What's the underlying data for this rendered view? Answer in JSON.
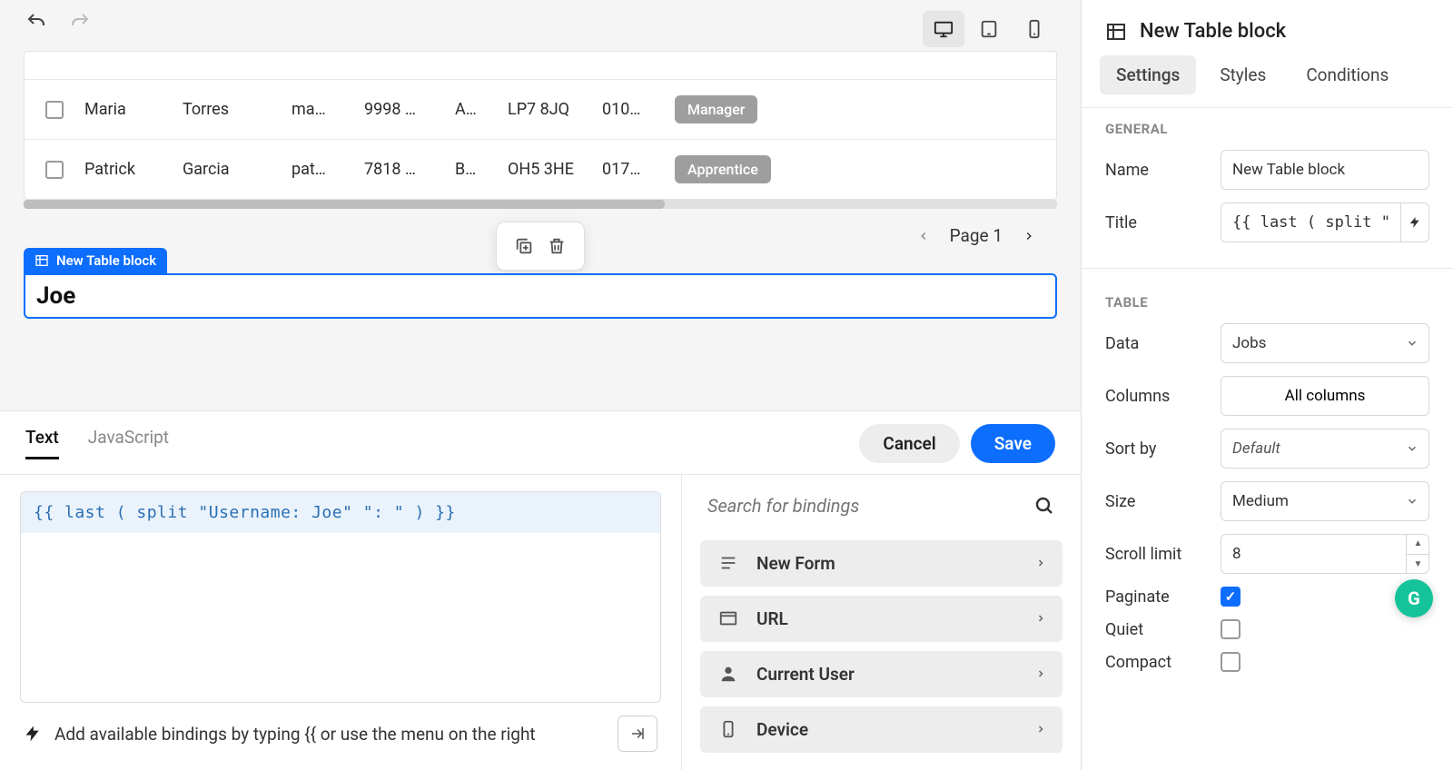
{
  "toolbar": {},
  "rows": [
    {
      "first": "Maria",
      "last": "Torres",
      "email": "ma…",
      "num": "9998 …",
      "col5": "A…",
      "post": "LP7 8JQ",
      "col7": "010…",
      "role": "Manager"
    },
    {
      "first": "Patrick",
      "last": "Garcia",
      "email": "pat…",
      "num": "7818 …",
      "col5": "B…",
      "post": "OH5 3HE",
      "col7": "017…",
      "role": "Apprentice"
    }
  ],
  "pager": {
    "label": "Page 1"
  },
  "block": {
    "tag": "New Table block",
    "title": "Joe"
  },
  "editor": {
    "tabs": {
      "text": "Text",
      "js": "JavaScript"
    },
    "cancel": "Cancel",
    "save": "Save",
    "code": "{{ last ( split \"Username: Joe\" \": \" ) }}",
    "hint": "Add available bindings by typing {{ or use the menu on the right"
  },
  "bindings": {
    "searchPlaceholder": "Search for bindings",
    "items": [
      "New Form",
      "URL",
      "Current User",
      "Device"
    ]
  },
  "rp": {
    "title": "New Table block",
    "tabs": {
      "settings": "Settings",
      "styles": "Styles",
      "conditions": "Conditions"
    },
    "general": {
      "heading": "GENERAL",
      "name": "Name",
      "name_val": "New Table block",
      "title": "Title",
      "title_val": "{{ last ( split \"Use…"
    },
    "table": {
      "heading": "TABLE",
      "data": "Data",
      "data_val": "Jobs",
      "columns": "Columns",
      "columns_val": "All columns",
      "sortby": "Sort by",
      "sortby_val": "Default",
      "size": "Size",
      "size_val": "Medium",
      "scroll": "Scroll limit",
      "scroll_val": "8",
      "paginate": "Paginate",
      "paginate_val": true,
      "quiet": "Quiet",
      "quiet_val": false,
      "compact": "Compact",
      "compact_val": false
    }
  }
}
